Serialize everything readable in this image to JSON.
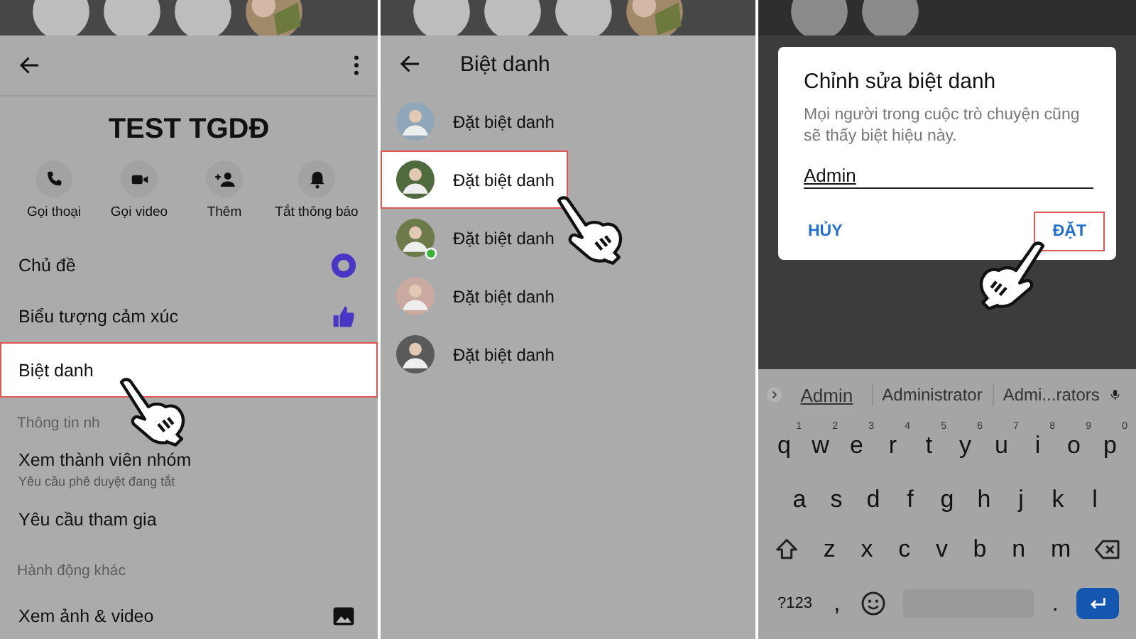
{
  "group_info": {
    "title": "TEST TGDĐ",
    "actions": [
      {
        "label": "Gọi thoại"
      },
      {
        "label": "Gọi video"
      },
      {
        "label": "Thêm"
      },
      {
        "label": "Tắt thông báo"
      }
    ],
    "rows": [
      {
        "kind": "theme",
        "label": "Chủ đề",
        "selected": false
      },
      {
        "kind": "emoji",
        "label": "Biểu tượng cảm xúc",
        "selected": false
      },
      {
        "kind": "plain",
        "label": "Biệt danh",
        "selected": true
      },
      {
        "kind": "section",
        "label": "Thông tin nh",
        "selected": false
      },
      {
        "kind": "plain",
        "label": "Xem thành viên nhóm",
        "sublabel": "Yêu cầu phê duyệt đang tắt",
        "selected": false
      },
      {
        "kind": "plain",
        "label": "Yêu cầu tham gia",
        "selected": false
      },
      {
        "kind": "section",
        "label": "Hành động khác",
        "selected": false
      },
      {
        "kind": "media",
        "label": "Xem ảnh & video",
        "selected": false
      }
    ]
  },
  "nickname_list": {
    "title": "Biệt danh",
    "rows": [
      {
        "label": "Đặt biệt danh",
        "selected": false,
        "online": false
      },
      {
        "label": "Đặt biệt danh",
        "selected": true,
        "online": false
      },
      {
        "label": "Đặt biệt danh",
        "selected": false,
        "online": true
      },
      {
        "label": "Đặt biệt danh",
        "selected": false,
        "online": false
      },
      {
        "label": "Đặt biệt danh",
        "selected": false,
        "online": false
      }
    ]
  },
  "edit_dialog": {
    "title": "Chỉnh sửa biệt danh",
    "description": "Mọi người trong cuộc trò chuyện cũng sẽ thấy biệt hiệu này.",
    "value": "Admin",
    "buttons": [
      {
        "label": "HỦY",
        "selected": false
      },
      {
        "label": "ĐẶT",
        "selected": true
      }
    ]
  },
  "keyboard": {
    "suggestions": [
      {
        "label": "Admin",
        "selected": true
      },
      {
        "label": "Administrator",
        "selected": false
      },
      {
        "label": "Admi...rators",
        "selected": false
      }
    ],
    "rows": [
      [
        {
          "label": "q",
          "hint": "1"
        },
        {
          "label": "w",
          "hint": "2"
        },
        {
          "label": "e",
          "hint": "3"
        },
        {
          "label": "r",
          "hint": "4"
        },
        {
          "label": "t",
          "hint": "5"
        },
        {
          "label": "y",
          "hint": "6"
        },
        {
          "label": "u",
          "hint": "7"
        },
        {
          "label": "i",
          "hint": "8"
        },
        {
          "label": "o",
          "hint": "9"
        },
        {
          "label": "p",
          "hint": "0"
        }
      ],
      [
        {
          "label": "a"
        },
        {
          "label": "s"
        },
        {
          "label": "d"
        },
        {
          "label": "f"
        },
        {
          "label": "g"
        },
        {
          "label": "h"
        },
        {
          "label": "j"
        },
        {
          "label": "k"
        },
        {
          "label": "l"
        }
      ],
      [
        {
          "label": "z"
        },
        {
          "label": "x"
        },
        {
          "label": "c"
        },
        {
          "label": "v"
        },
        {
          "label": "b"
        },
        {
          "label": "n"
        },
        {
          "label": "m"
        }
      ]
    ],
    "bottom_keys": [
      "?123",
      ",",
      "."
    ]
  }
}
